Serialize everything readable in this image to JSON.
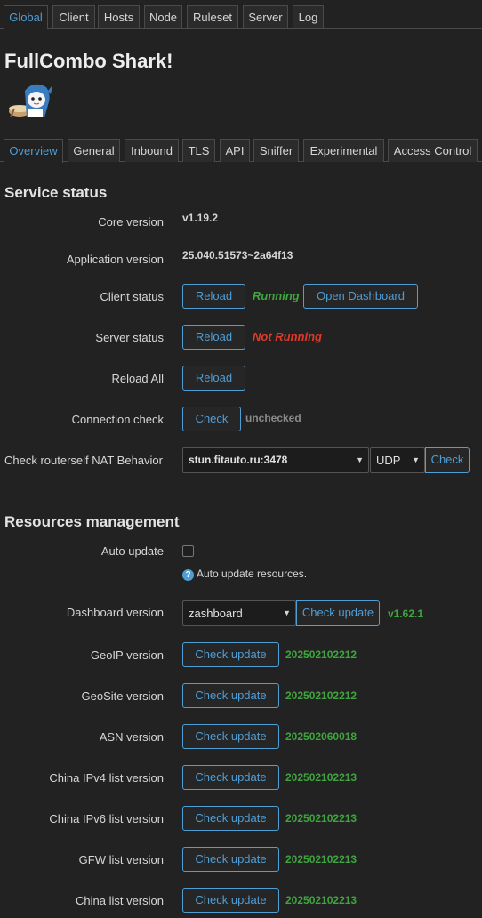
{
  "top_tabs": [
    "Global",
    "Client",
    "Hosts",
    "Node",
    "Ruleset",
    "Server",
    "Log"
  ],
  "page_title": "FullCombo Shark!",
  "sub_tabs": [
    "Overview",
    "General",
    "Inbound",
    "TLS",
    "API",
    "Sniffer",
    "Experimental",
    "Access Control"
  ],
  "service_status": {
    "title": "Service status",
    "core_version_label": "Core version",
    "core_version": "v1.19.2",
    "app_version_label": "Application version",
    "app_version": "25.040.51573~2a64f13",
    "client_status_label": "Client status",
    "client_reload": "Reload",
    "client_state": "Running",
    "open_dashboard": "Open Dashboard",
    "server_status_label": "Server status",
    "server_reload": "Reload",
    "server_state": "Not Running",
    "reload_all_label": "Reload All",
    "reload_all": "Reload",
    "conn_check_label": "Connection check",
    "conn_check_btn": "Check",
    "conn_state": "unchecked",
    "nat_label": "Check routerself NAT Behavior",
    "stun_server": "stun.fitauto.ru:3478",
    "protocol": "UDP",
    "nat_check_btn": "Check"
  },
  "resources": {
    "title": "Resources management",
    "auto_update_label": "Auto update",
    "auto_update_checked": false,
    "auto_update_help": "Auto update resources.",
    "dashboard_label": "Dashboard version",
    "dashboard_select": "zashboard",
    "dashboard_check": "Check update",
    "dashboard_version": "v1.62.1",
    "items": [
      {
        "label": "GeoIP version",
        "button": "Check update",
        "version": "202502102212"
      },
      {
        "label": "GeoSite version",
        "button": "Check update",
        "version": "202502102212"
      },
      {
        "label": "ASN version",
        "button": "Check update",
        "version": "202502060018"
      },
      {
        "label": "China IPv4 list version",
        "button": "Check update",
        "version": "202502102213"
      },
      {
        "label": "China IPv6 list version",
        "button": "Check update",
        "version": "202502102213"
      },
      {
        "label": "GFW list version",
        "button": "Check update",
        "version": "202502102213"
      },
      {
        "label": "China list version",
        "button": "Check update",
        "version": "202502102213"
      }
    ]
  },
  "colors": {
    "accent": "#4f9ed6",
    "ok": "#3fa53f",
    "bad": "#e0392a",
    "background": "#222222"
  }
}
